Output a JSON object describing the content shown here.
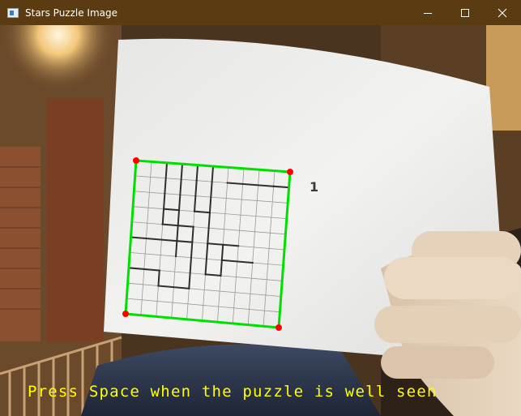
{
  "window": {
    "title": "Stars Puzzle Image",
    "controls": {
      "minimize_icon": "minimize-icon",
      "maximize_icon": "maximize-icon",
      "close_icon": "close-icon"
    }
  },
  "camera_view": {
    "page_label": "1",
    "grid_size": 10,
    "detection_color": "#00e000",
    "corner_color": "#ff0000",
    "instruction": "Press Space when the puzzle is well seen",
    "instruction_color": "#ffff00"
  },
  "colors": {
    "titlebar": "#5a3b12",
    "paper": "#f1f1ef"
  }
}
